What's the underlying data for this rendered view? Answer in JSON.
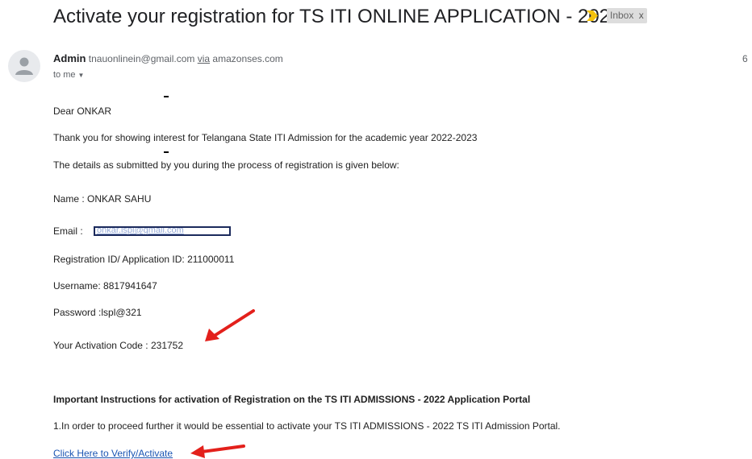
{
  "header": {
    "subject": "Activate your registration for TS ITI ONLINE APPLICATION - 2022",
    "label_badge": "Inbox",
    "label_close": "x",
    "importance_color": "#f4c20d"
  },
  "sender": {
    "name": "Admin",
    "address": "tnauonlinein@gmail.com",
    "via_label": "via",
    "via_domain": "amazonses.com",
    "recipient": "to me",
    "date_partial": "6"
  },
  "body": {
    "greeting": "Dear ONKAR",
    "intro": "Thank you for showing interest for Telangana State ITI Admission for the academic year  2022-2023",
    "details_intro": "The details as submitted by you during the process of registration is given below:",
    "name_line": "Name : ONKAR SAHU",
    "email_label": "Email :",
    "email_value_visible": "onkar.lspl@gmail.com",
    "registration_line": "Registration ID/ Application ID: 211000011",
    "username_line": "Username: 8817941647",
    "password_line": "Password :lspl@321",
    "activation_line": "Your Activation Code : 231752",
    "instructions_heading": "Important Instructions for activation of Registration on the TS ITI ADMISSIONS - 2022 Application Portal",
    "instruction_1": "1.In order to proceed further it would be essential to activate your TS ITI ADMISSIONS - 2022 TS ITI Admission Portal.",
    "verify_link": "Click Here to Verify/Activate"
  },
  "colors": {
    "link": "#1a55b3",
    "annotation_arrow": "#e3201b",
    "redaction_border": "#1b2a5c"
  }
}
